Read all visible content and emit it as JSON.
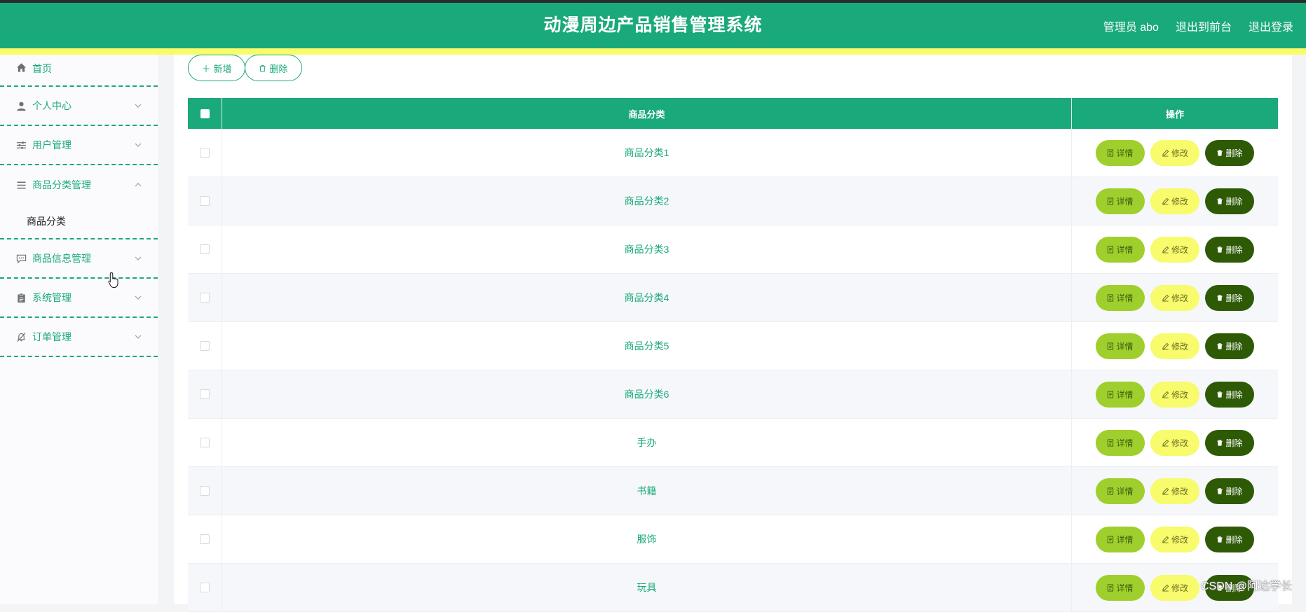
{
  "header": {
    "title": "动漫周边产品销售管理系统",
    "user": "管理员 abo",
    "back_to_front": "退出到前台",
    "logout": "退出登录"
  },
  "sidebar": {
    "items": [
      {
        "label": "首页",
        "icon": "home-icon"
      },
      {
        "label": "个人中心",
        "icon": "user-icon"
      },
      {
        "label": "用户管理",
        "icon": "sliders-icon"
      },
      {
        "label": "商品分类管理",
        "icon": "list-icon",
        "expanded": true,
        "children": [
          {
            "label": "商品分类"
          }
        ]
      },
      {
        "label": "商品信息管理",
        "icon": "chat-icon"
      },
      {
        "label": "系统管理",
        "icon": "clipboard-icon"
      },
      {
        "label": "订单管理",
        "icon": "bell-off-icon"
      }
    ]
  },
  "toolbar": {
    "add_label": "新增",
    "delete_label": "删除"
  },
  "table": {
    "columns": [
      "商品分类",
      "操作"
    ],
    "rows": [
      "商品分类1",
      "商品分类2",
      "商品分类3",
      "商品分类4",
      "商品分类5",
      "商品分类6",
      "手办",
      "书籍",
      "服饰",
      "玩具"
    ],
    "actions": {
      "detail": "详情",
      "edit": "修改",
      "delete": "删除"
    }
  },
  "watermark": "CSDN @阿达学长",
  "colors": {
    "primary": "#1aa97a",
    "accent_yellow": "#f8fb6a",
    "detail_btn": "#9fcf2c",
    "edit_btn": "#f7fb6c",
    "delete_btn": "#2e5a06"
  }
}
